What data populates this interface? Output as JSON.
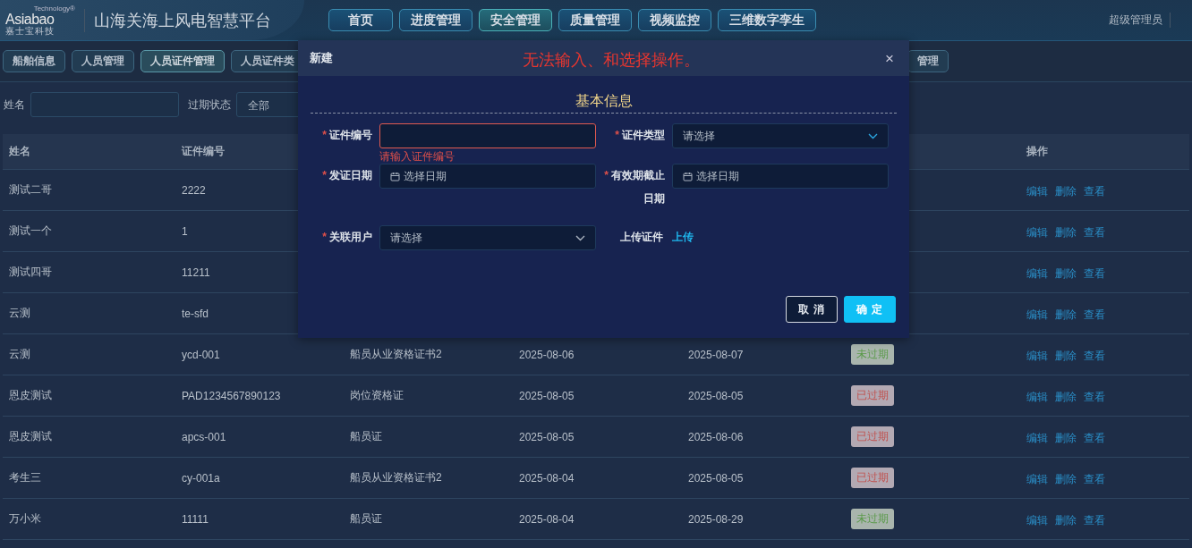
{
  "header": {
    "logo": {
      "brand": "Asiabao",
      "tagline": "Technology®",
      "subtitle": "嘉士宝科技"
    },
    "title": "山海关海上风电智慧平台",
    "nav": [
      {
        "label": "首页",
        "selected": false
      },
      {
        "label": "进度管理",
        "selected": false
      },
      {
        "label": "安全管理",
        "selected": true
      },
      {
        "label": "质量管理",
        "selected": false
      },
      {
        "label": "视频监控",
        "selected": false
      },
      {
        "label": "三维数字孪生",
        "selected": false
      }
    ],
    "user": "超级管理员"
  },
  "sub_tabs": [
    {
      "label": "船舶信息",
      "selected": false
    },
    {
      "label": "人员管理",
      "selected": false
    },
    {
      "label": "人员证件管理",
      "selected": true
    },
    {
      "label": "人员证件类",
      "selected": false
    },
    {
      "label": "管理",
      "selected": false
    }
  ],
  "filters": [
    {
      "kind": "input",
      "label": "姓名"
    },
    {
      "kind": "select",
      "label": "过期状态",
      "value": "全部"
    }
  ],
  "table": {
    "headers": {
      "name": "姓名",
      "number": "证件编号",
      "actions": "操作"
    },
    "rows": [
      {
        "name": "测试二哥",
        "number": "2222",
        "actions": [
          "编辑",
          "删除",
          "查看"
        ]
      },
      {
        "name": "测试一个",
        "number": "1",
        "actions": [
          "编辑",
          "删除",
          "查看"
        ]
      },
      {
        "name": "测试四哥",
        "number": "11211",
        "actions": [
          "编辑",
          "删除",
          "查看"
        ]
      },
      {
        "name": "云测",
        "number": "te-sfd",
        "actions": [
          "编辑",
          "删除",
          "查看"
        ]
      },
      {
        "name": "云测",
        "number": "ycd-001",
        "cert_type": "船员从业资格证书2",
        "issue_date": "2025-08-06",
        "expiry_date": "2025-08-07",
        "status": {
          "label": "未过期",
          "expired": false
        },
        "actions": [
          "编辑",
          "删除",
          "查看"
        ]
      },
      {
        "name": "恩皮测试",
        "number": "PAD1234567890123",
        "cert_type": "岗位资格证",
        "issue_date": "2025-08-05",
        "expiry_date": "2025-08-05",
        "status": {
          "label": "已过期",
          "expired": true
        },
        "actions": [
          "编辑",
          "删除",
          "查看"
        ]
      },
      {
        "name": "恩皮测试",
        "number": "apcs-001",
        "cert_type": "船员证",
        "issue_date": "2025-08-05",
        "expiry_date": "2025-08-06",
        "status": {
          "label": "已过期",
          "expired": true
        },
        "actions": [
          "编辑",
          "删除",
          "查看"
        ]
      },
      {
        "name": "考生三",
        "number": "cy-001a",
        "cert_type": "船员从业资格证书2",
        "issue_date": "2025-08-04",
        "expiry_date": "2025-08-05",
        "status": {
          "label": "已过期",
          "expired": true
        },
        "actions": [
          "编辑",
          "删除",
          "查看"
        ]
      },
      {
        "name": "万小米",
        "number": "11111",
        "cert_type": "船员证",
        "issue_date": "2025-08-04",
        "expiry_date": "2025-08-29",
        "status": {
          "label": "未过期",
          "expired": false
        },
        "actions": [
          "编辑",
          "删除",
          "查看"
        ]
      }
    ]
  },
  "dialog": {
    "title": "新建",
    "notice": "无法输入、和选择操作。",
    "close": "×",
    "required_mark": "*",
    "section": "基本信息",
    "fields": [
      {
        "kind": "input",
        "label": "证件编号",
        "required": true,
        "error": "请输入证件编号"
      },
      {
        "kind": "select",
        "label": "证件类型",
        "required": true,
        "placeholder": "请选择"
      },
      {
        "kind": "date",
        "label": "发证日期",
        "required": true,
        "placeholder": "选择日期"
      },
      {
        "kind": "date",
        "label": "有效期截止日期",
        "required": true,
        "placeholder": "选择日期"
      },
      {
        "kind": "select",
        "label": "关联用户",
        "required": true,
        "placeholder": "请选择"
      },
      {
        "kind": "upload",
        "label": "上传证件",
        "required": false,
        "link": "上传"
      }
    ],
    "buttons": [
      {
        "kind": "secondary",
        "label": "取 消"
      },
      {
        "kind": "primary",
        "label": "确 定"
      }
    ]
  }
}
